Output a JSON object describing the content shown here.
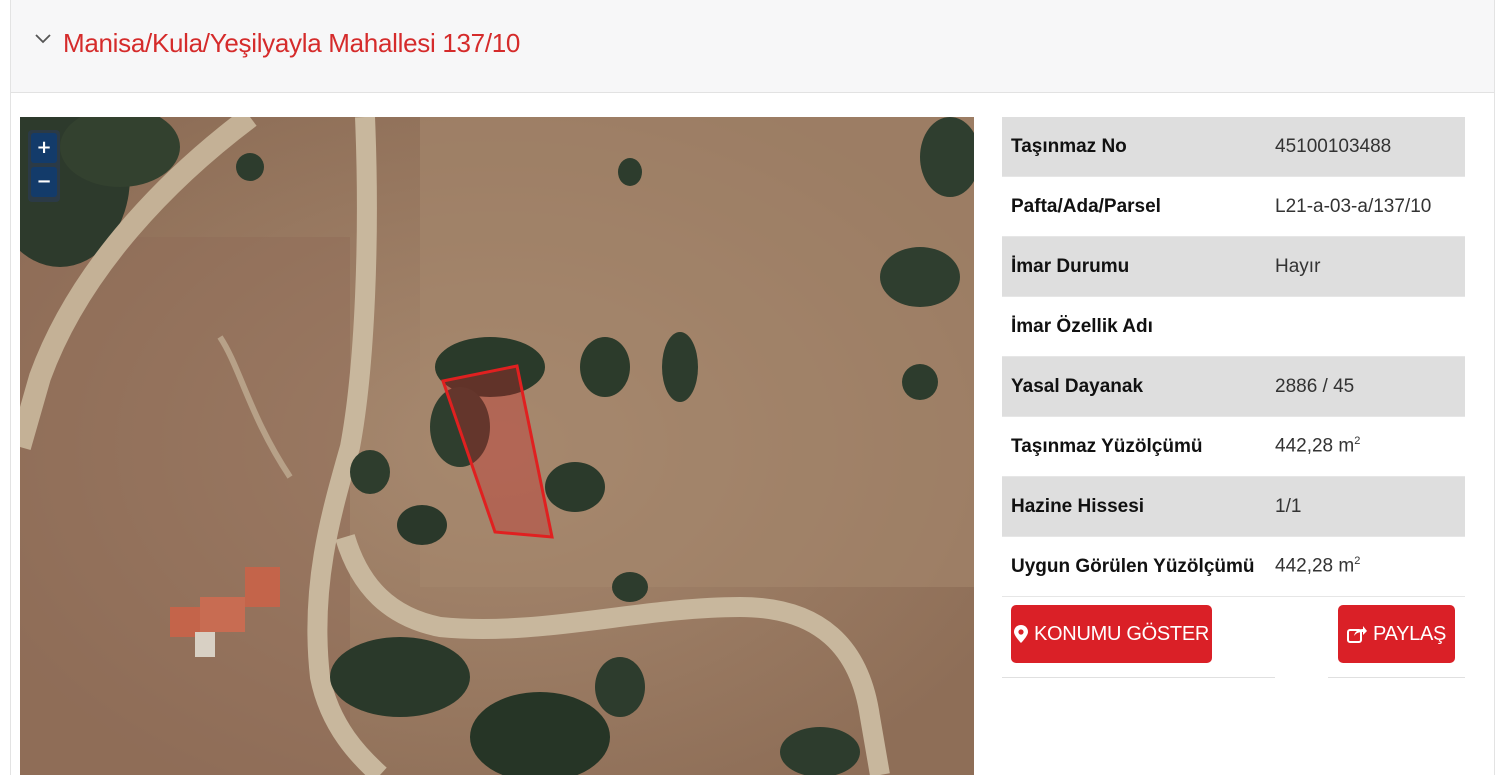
{
  "header": {
    "title": "Manisa/Kula/Yeşilyayla Mahallesi 137/10"
  },
  "map": {
    "zoom_in": "+",
    "zoom_out": "−",
    "parcel_color": "#e02020"
  },
  "info": {
    "rows": [
      {
        "key": "Taşınmaz No",
        "value": "45100103488"
      },
      {
        "key": "Pafta/Ada/Parsel",
        "value": "L21-a-03-a/137/10"
      },
      {
        "key": "İmar Durumu",
        "value": "Hayır"
      },
      {
        "key": "İmar Özellik Adı",
        "value": ""
      },
      {
        "key": "Yasal Dayanak",
        "value": "2886 / 45"
      },
      {
        "key": "Taşınmaz Yüzölçümü",
        "value": "442,28 m",
        "unit_sup": "2"
      },
      {
        "key": "Hazine Hissesi",
        "value": "1/1"
      },
      {
        "key": "Uygun Görülen Yüzölçümü",
        "value": "442,28 m",
        "unit_sup": "2"
      }
    ]
  },
  "actions": {
    "show_location": "KONUMU GÖSTER",
    "share": "PAYLAŞ"
  },
  "colors": {
    "accent": "#da2027",
    "title": "#d52b2b"
  },
  "icons": {
    "chevron": "chevron-down-icon",
    "location": "map-marker-icon",
    "share": "share-icon"
  }
}
